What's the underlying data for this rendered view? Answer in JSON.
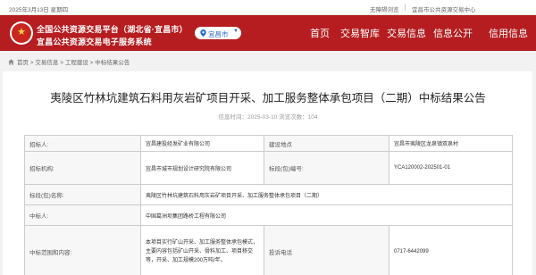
{
  "topbar": {
    "date": "2025年3月13日 星期四",
    "login": "无障碍浏览",
    "account": "宜昌市公共资源交易中心",
    "site": ""
  },
  "header": {
    "title_line1": "全国公共资源交易平台（湖北省·宜昌市）",
    "title_line2": "宜昌公共资源交易电子服务系统",
    "city": "宜昌市",
    "nav": [
      "首页",
      "交易智库",
      "交易信息",
      "信息公开",
      "信用信息"
    ]
  },
  "breadcrumb": {
    "items": [
      "首页",
      "交易信息",
      "工程建设",
      "中标结果公告"
    ],
    "separator": " > "
  },
  "article": {
    "title": "夷陵区竹林坑建筑石料用灰岩矿项目开采、加工服务整体承包项目（二期）中标结果公告",
    "meta": "信息时间：2025-03-10  浏览次数：104"
  },
  "table": {
    "rows": [
      {
        "l1": "招标人:",
        "v1": "宜昌建投经发矿业有限公司",
        "l2": "建设地点",
        "v2": "宜昌市夷陵区龙泉镇双泉村"
      },
      {
        "l1": "招标机构:",
        "v1": "宜昌市城市规划设计研究院有限公司",
        "l2": "标段(包)编号:",
        "v2": "YCA120002-202501-01"
      },
      {
        "l1": "标段(包)名称:",
        "v1": "夷陵区竹林坑建筑石料用灰岩矿项目开采、加工服务整体承包项目（二期）"
      },
      {
        "l1": "中标人:",
        "v1": "中国葛洲坝集团路桥工程有限公司"
      },
      {
        "l1": "中标范围和内容:",
        "v1": "本项目实行矿山开采、加工服务整体承包模式，主要内容包括矿山开采、骨料加工、项目移交等，开采、加工规模200万吨/年。",
        "l2": "投诉电话",
        "v2": "0717-6442099"
      }
    ]
  },
  "colors": {
    "header_red": "#b51d20",
    "city_blue": "#2a6ac8",
    "logo_gold": "#f5d04a"
  }
}
